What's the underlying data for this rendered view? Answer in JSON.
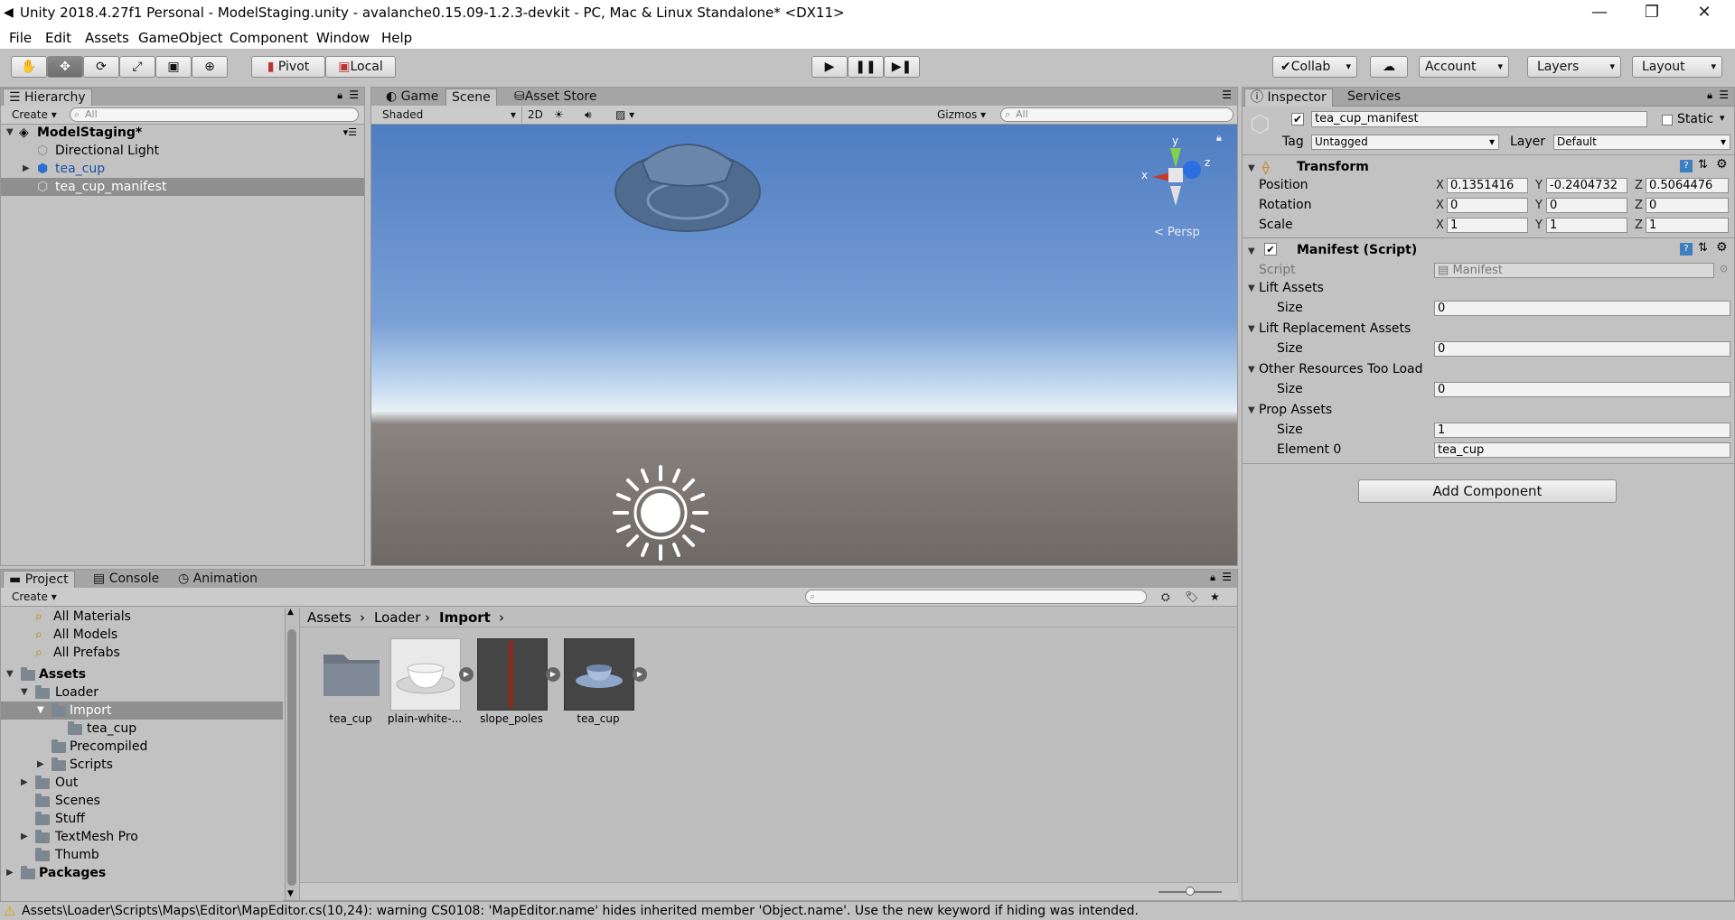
{
  "window": {
    "title": "Unity 2018.4.27f1 Personal - ModelStaging.unity - avalanche0.15.09-1.2.3-devkit - PC, Mac & Linux Standalone* <DX11>"
  },
  "menu": [
    "File",
    "Edit",
    "Assets",
    "GameObject",
    "Component",
    "Window",
    "Help"
  ],
  "toolbar": {
    "pivot": "Pivot",
    "local": "Local",
    "collab": "Collab",
    "account": "Account",
    "layers": "Layers",
    "layout": "Layout"
  },
  "hierarchy": {
    "tab": "Hierarchy",
    "create": "Create",
    "search_placeholder": "All",
    "scene": "ModelStaging*",
    "items": [
      "Directional Light",
      "tea_cup",
      "tea_cup_manifest"
    ]
  },
  "scene_view": {
    "tabs": [
      "Game",
      "Scene",
      "Asset Store"
    ],
    "shading": "Shaded",
    "mode_2d": "2D",
    "gizmos": "Gizmos",
    "search_placeholder": "All",
    "persp": "< Persp",
    "gizmo_axes": {
      "x": "x",
      "y": "y",
      "z": "z"
    }
  },
  "inspector": {
    "tabs": [
      "Inspector",
      "Services"
    ],
    "object_name": "tea_cup_manifest",
    "static_label": "Static",
    "tag_label": "Tag",
    "tag_value": "Untagged",
    "layer_label": "Layer",
    "layer_value": "Default",
    "transform": {
      "title": "Transform",
      "position_label": "Position",
      "position": [
        "0.1351416",
        "-0.2404732",
        "0.5064476"
      ],
      "rotation_label": "Rotation",
      "rotation": [
        "0",
        "0",
        "0"
      ],
      "scale_label": "Scale",
      "scale": [
        "1",
        "1",
        "1"
      ]
    },
    "manifest": {
      "title": "Manifest (Script)",
      "script_label": "Script",
      "script_value": "Manifest",
      "lift_assets": "Lift Assets",
      "lift_assets_size": "0",
      "lift_replacement": "Lift Replacement Assets",
      "lift_replacement_size": "0",
      "other_resources": "Other Resources Too Load",
      "other_resources_size": "0",
      "prop_assets": "Prop Assets",
      "prop_assets_size": "1",
      "size_label": "Size",
      "element0_label": "Element 0",
      "element0_value": "tea_cup"
    },
    "add_component": "Add Component"
  },
  "project": {
    "tabs": [
      "Project",
      "Console",
      "Animation"
    ],
    "create": "Create",
    "favorites": [
      "All Materials",
      "All Models",
      "All Prefabs"
    ],
    "tree": {
      "assets": "Assets",
      "loader": "Loader",
      "import": "Import",
      "tea_cup": "tea_cup",
      "precompiled": "Precompiled",
      "scripts": "Scripts",
      "out": "Out",
      "scenes": "Scenes",
      "stuff": "Stuff",
      "textmesh": "TextMesh Pro",
      "thumb": "Thumb",
      "packages": "Packages"
    },
    "breadcrumb": [
      "Assets",
      "Loader",
      "Import"
    ],
    "assets": [
      "tea_cup",
      "plain-white-...",
      "slope_poles",
      "tea_cup"
    ]
  },
  "status": {
    "message": "Assets\\Loader\\Scripts\\Maps\\Editor\\MapEditor.cs(10,24): warning CS0108: 'MapEditor.name' hides inherited member 'Object.name'. Use the new keyword if hiding was intended.",
    "warning_color": "#d9a300"
  }
}
